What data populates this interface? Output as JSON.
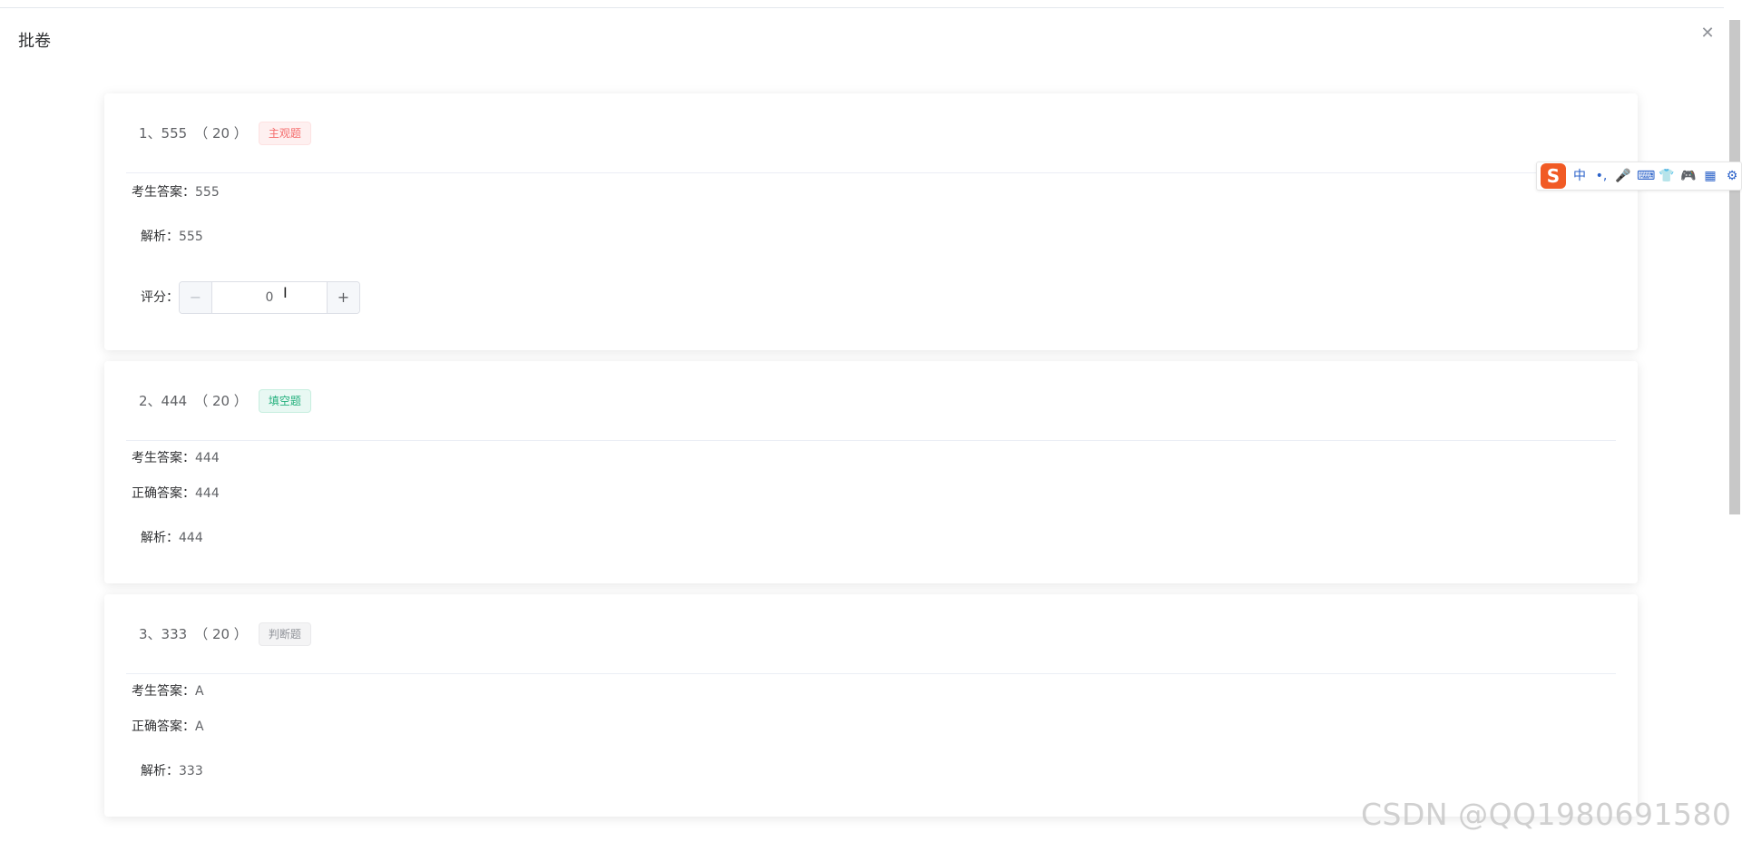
{
  "dialog": {
    "title": "批卷",
    "close_icon": "close-icon"
  },
  "questions": [
    {
      "number_title": "1、555",
      "score": "（ 20 ）",
      "tag": "主观题",
      "student_answer_label": "考生答案：",
      "student_answer": "555",
      "analysis_label": "解析：",
      "analysis": "555",
      "grade_label": "评分：",
      "grade_value": "0",
      "minus_icon": "minus-icon",
      "plus_icon": "plus-icon"
    },
    {
      "number_title": "2、444",
      "score": "（ 20 ）",
      "tag": "填空题",
      "student_answer_label": "考生答案：",
      "student_answer": "444",
      "correct_answer_label": "正确答案：",
      "correct_answer": "444",
      "analysis_label": "解析：",
      "analysis": "444"
    },
    {
      "number_title": "3、333",
      "score": "（ 20 ）",
      "tag": "判断题",
      "student_answer_label": "考生答案：",
      "student_answer": "A",
      "correct_answer_label": "正确答案：",
      "correct_answer": "A",
      "analysis_label": "解析：",
      "analysis": "333"
    }
  ],
  "ime_toolbar": {
    "logo": "S",
    "mode": "中",
    "punct": "•,",
    "icons": [
      "mic-icon",
      "keyboard-icon",
      "skin-icon",
      "game-icon",
      "apps-icon",
      "settings-icon"
    ]
  },
  "watermark": "CSDN @QQ1980691580",
  "colors": {
    "tag_subjective": "#f56c6c",
    "tag_fill": "#23b07d",
    "tag_judge": "#909399"
  }
}
